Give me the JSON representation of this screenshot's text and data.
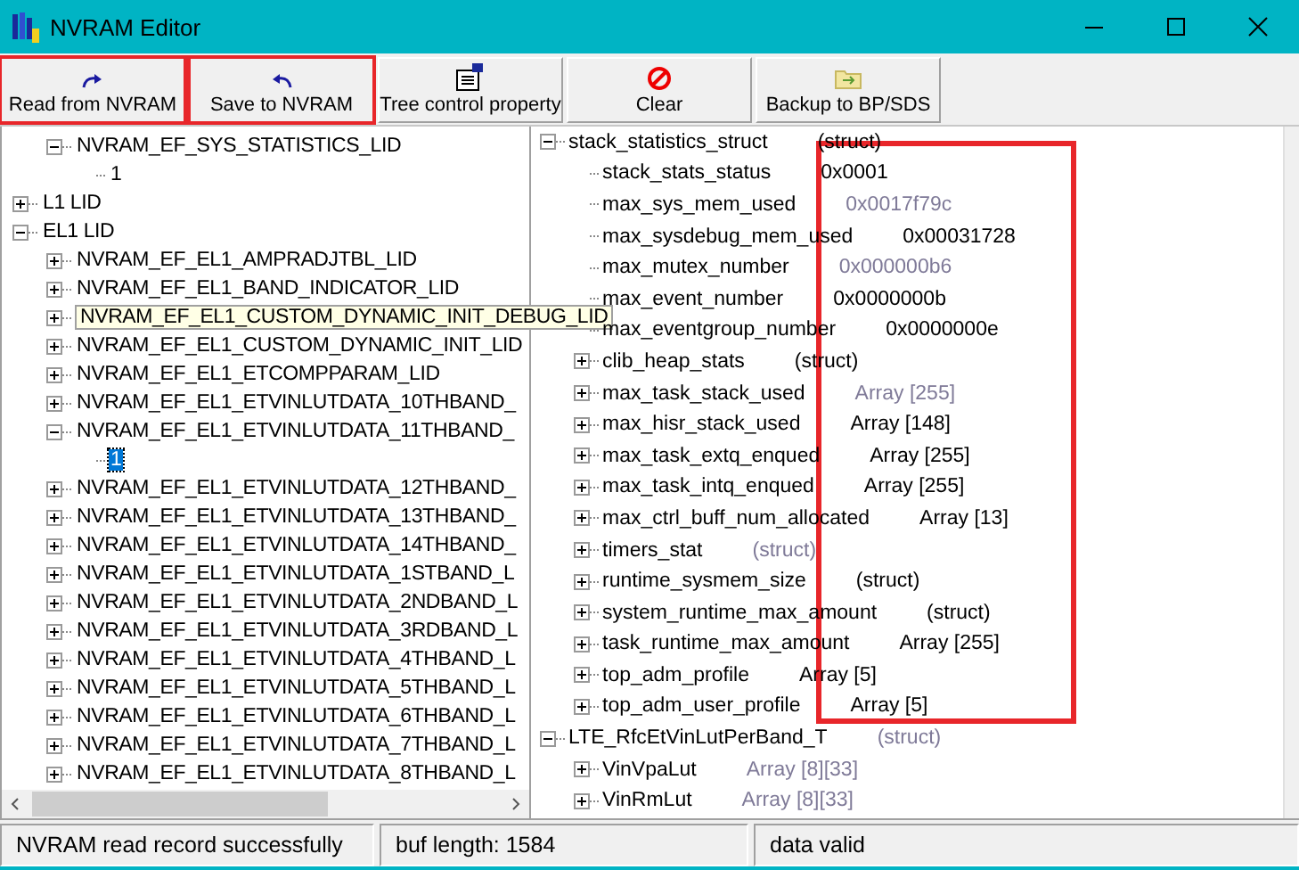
{
  "window": {
    "title": "NVRAM Editor"
  },
  "toolbar": [
    {
      "label": "Read from NVRAM",
      "kind": "read",
      "highlighted": true
    },
    {
      "label": "Save to NVRAM",
      "kind": "save",
      "highlighted": true
    },
    {
      "label": "Tree control property",
      "kind": "property",
      "highlighted": false
    },
    {
      "label": "Clear",
      "kind": "clear",
      "highlighted": false
    },
    {
      "label": "Backup to BP/SDS",
      "kind": "backup",
      "highlighted": false
    }
  ],
  "record_tree": [
    {
      "children": [
        {
          "label": "NVRAM_EF_SYS_STATISTICS_LID",
          "expanded": true,
          "selected": false,
          "hovered": false,
          "children": [
            {
              "label": "1",
              "selected": false,
              "hovered": false
            }
          ]
        }
      ]
    },
    {
      "label": "L1 LID",
      "expanded": false,
      "selected": false,
      "hovered": false
    },
    {
      "label": "EL1 LID",
      "expanded": true,
      "selected": false,
      "hovered": false,
      "children": [
        {
          "label": "NVRAM_EF_EL1_AMPRADJTBL_LID",
          "expanded": false,
          "selected": false,
          "hovered": false
        },
        {
          "label": "NVRAM_EF_EL1_BAND_INDICATOR_LID",
          "expanded": false,
          "selected": false,
          "hovered": false
        },
        {
          "label": "NVRAM_EF_EL1_CUSTOM_DYNAMIC_INIT_DEBUG_LID",
          "expanded": false,
          "selected": false,
          "hovered": true
        },
        {
          "label": "NVRAM_EF_EL1_CUSTOM_DYNAMIC_INIT_LID",
          "expanded": false,
          "selected": false,
          "hovered": false
        },
        {
          "label": "NVRAM_EF_EL1_ETCOMPPARAM_LID",
          "expanded": false,
          "selected": false,
          "hovered": false
        },
        {
          "label": "NVRAM_EF_EL1_ETVINLUTDATA_10THBAND_",
          "expanded": false,
          "selected": false,
          "hovered": false
        },
        {
          "label": "NVRAM_EF_EL1_ETVINLUTDATA_11THBAND_",
          "expanded": true,
          "selected": false,
          "hovered": false,
          "children": [
            {
              "label": "1",
              "selected": true,
              "hovered": false
            }
          ]
        },
        {
          "label": "NVRAM_EF_EL1_ETVINLUTDATA_12THBAND_",
          "expanded": false,
          "selected": false,
          "hovered": false
        },
        {
          "label": "NVRAM_EF_EL1_ETVINLUTDATA_13THBAND_",
          "expanded": false,
          "selected": false,
          "hovered": false
        },
        {
          "label": "NVRAM_EF_EL1_ETVINLUTDATA_14THBAND_",
          "expanded": false,
          "selected": false,
          "hovered": false
        },
        {
          "label": "NVRAM_EF_EL1_ETVINLUTDATA_1STBAND_L",
          "expanded": false,
          "selected": false,
          "hovered": false
        },
        {
          "label": "NVRAM_EF_EL1_ETVINLUTDATA_2NDBAND_L",
          "expanded": false,
          "selected": false,
          "hovered": false
        },
        {
          "label": "NVRAM_EF_EL1_ETVINLUTDATA_3RDBAND_L",
          "expanded": false,
          "selected": false,
          "hovered": false
        },
        {
          "label": "NVRAM_EF_EL1_ETVINLUTDATA_4THBAND_L",
          "expanded": false,
          "selected": false,
          "hovered": false
        },
        {
          "label": "NVRAM_EF_EL1_ETVINLUTDATA_5THBAND_L",
          "expanded": false,
          "selected": false,
          "hovered": false
        },
        {
          "label": "NVRAM_EF_EL1_ETVINLUTDATA_6THBAND_L",
          "expanded": false,
          "selected": false,
          "hovered": false
        },
        {
          "label": "NVRAM_EF_EL1_ETVINLUTDATA_7THBAND_L",
          "expanded": false,
          "selected": false,
          "hovered": false
        },
        {
          "label": "NVRAM_EF_EL1_ETVINLUTDATA_8THBAND_L",
          "expanded": false,
          "selected": false,
          "hovered": false
        }
      ]
    }
  ],
  "struct_tree": {
    "highlight_box": true,
    "items": [
      {
        "name": "stack_statistics_struct",
        "value": "(struct)",
        "dim": false,
        "expanded": true,
        "children": [
          {
            "name": "stack_stats_status",
            "value": "0x0001",
            "dim": false
          },
          {
            "name": "max_sys_mem_used",
            "value": "0x0017f79c",
            "dim": true
          },
          {
            "name": "max_sysdebug_mem_used",
            "value": "0x00031728",
            "dim": false
          },
          {
            "name": "max_mutex_number",
            "value": "0x000000b6",
            "dim": true
          },
          {
            "name": "max_event_number",
            "value": "0x0000000b",
            "dim": false
          },
          {
            "name": "max_eventgroup_number",
            "value": "0x0000000e",
            "dim": false
          },
          {
            "name": "clib_heap_stats",
            "value": "(struct)",
            "dim": false,
            "expanded": false
          },
          {
            "name": "max_task_stack_used",
            "value": "Array [255]",
            "dim": true,
            "expanded": false
          },
          {
            "name": "max_hisr_stack_used",
            "value": "Array [148]",
            "dim": false,
            "expanded": false
          },
          {
            "name": "max_task_extq_enqued",
            "value": "Array [255]",
            "dim": false,
            "expanded": false
          },
          {
            "name": "max_task_intq_enqued",
            "value": "Array [255]",
            "dim": false,
            "expanded": false
          },
          {
            "name": "max_ctrl_buff_num_allocated",
            "value": "Array [13]",
            "dim": false,
            "expanded": false
          },
          {
            "name": "timers_stat",
            "value": "(struct)",
            "dim": true,
            "expanded": false
          },
          {
            "name": "runtime_sysmem_size",
            "value": "(struct)",
            "dim": false,
            "expanded": false
          },
          {
            "name": "system_runtime_max_amount",
            "value": "(struct)",
            "dim": false,
            "expanded": false
          },
          {
            "name": "task_runtime_max_amount",
            "value": "Array [255]",
            "dim": false,
            "expanded": false
          },
          {
            "name": "top_adm_profile",
            "value": "Array [5]",
            "dim": false,
            "expanded": false
          },
          {
            "name": "top_adm_user_profile",
            "value": "Array [5]",
            "dim": false,
            "expanded": false
          }
        ]
      },
      {
        "name": "LTE_RfcEtVinLutPerBand_T",
        "value": "(struct)",
        "dim": true,
        "expanded": true,
        "children": [
          {
            "name": "VinVpaLut",
            "value": "Array [8][33]",
            "dim": true,
            "expanded": false
          },
          {
            "name": "VinRmLut",
            "value": "Array [8][33]",
            "dim": true,
            "expanded": false
          }
        ]
      }
    ]
  },
  "status_bar": [
    "NVRAM read record successfully",
    "buf length: 1584",
    "data valid"
  ]
}
